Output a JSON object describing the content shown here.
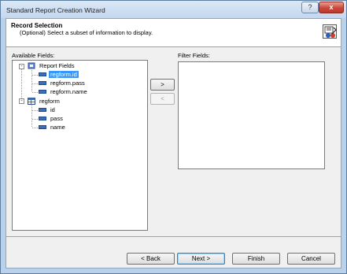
{
  "window": {
    "title": "Standard Report Creation Wizard",
    "help_glyph": "?",
    "close_glyph": "x"
  },
  "header": {
    "title": "Record Selection",
    "description": "(Optional)  Select a subset of information to display."
  },
  "available_fields": {
    "label": "Available Fields:",
    "tree": [
      {
        "label": "Report Fields",
        "icon": "report-fields-icon",
        "expander": "-",
        "children": [
          {
            "label": "regform.id",
            "selected": true
          },
          {
            "label": "regform.pass",
            "selected": false
          },
          {
            "label": "regform.name",
            "selected": false
          }
        ]
      },
      {
        "label": "regform",
        "icon": "table-icon",
        "expander": "-",
        "children": [
          {
            "label": "id"
          },
          {
            "label": "pass"
          },
          {
            "label": "name"
          }
        ]
      }
    ]
  },
  "filter_fields": {
    "label": "Filter Fields:"
  },
  "transfer": {
    "add_label": ">",
    "remove_label": "<"
  },
  "footer": {
    "back_label": "< Back",
    "next_label": "Next >",
    "finish_label": "Finish",
    "cancel_label": "Cancel"
  },
  "colors": {
    "selection": "#3399ff",
    "close_button": "#c9473a"
  }
}
